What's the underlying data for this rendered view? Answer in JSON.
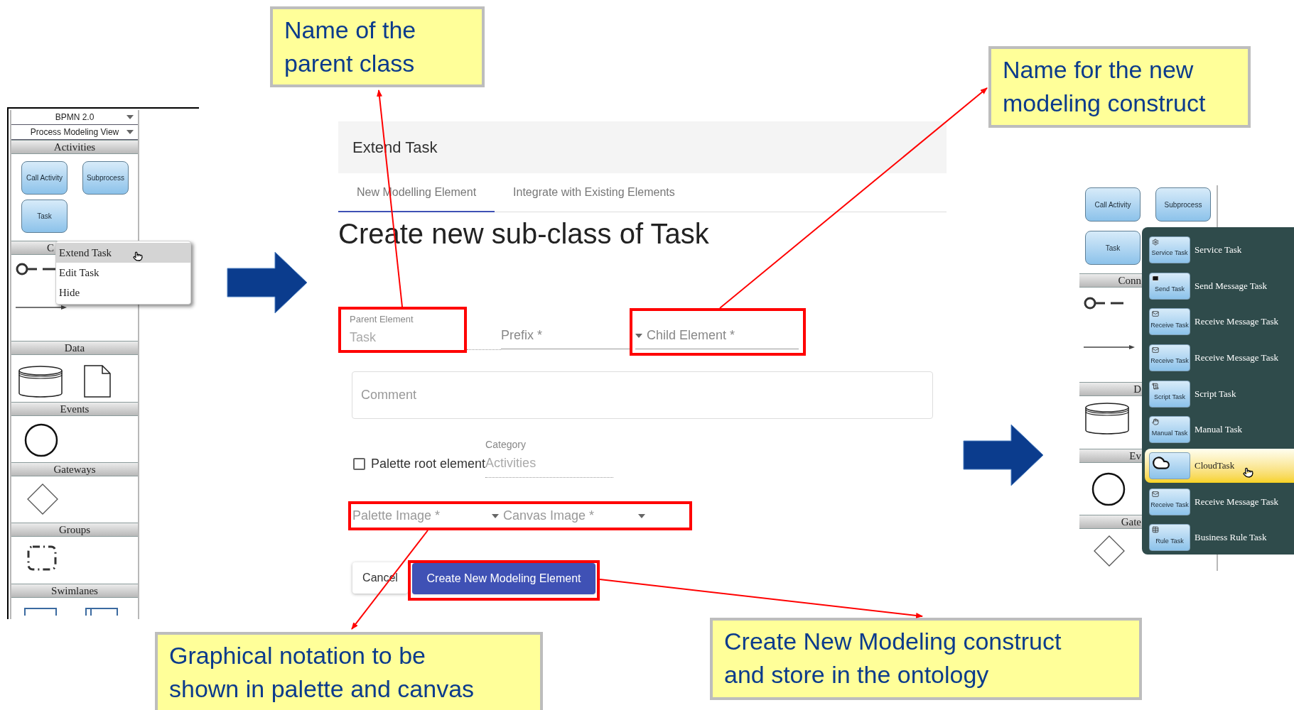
{
  "callouts": [
    {
      "text": "Name of the parent class"
    },
    {
      "text": "Name for the new modeling construct"
    },
    {
      "text": "Graphical notation to be shown in palette and canvas"
    },
    {
      "text": "Create New Modeling construct and store in the ontology"
    }
  ],
  "left_palette": {
    "selectors": [
      "BPMN 2.0",
      "Process Modeling View"
    ],
    "sections": [
      {
        "kind": "activities",
        "title": "Activities",
        "items": [
          {
            "label": "Call Activity"
          },
          {
            "label": "Subprocess"
          },
          {
            "label": "Task"
          }
        ]
      },
      {
        "kind": "connectors",
        "title": "C"
      },
      {
        "kind": "data",
        "title": "Data"
      },
      {
        "kind": "events",
        "title": "Events"
      },
      {
        "kind": "gateways",
        "title": "Gateways"
      },
      {
        "kind": "groups",
        "title": "Groups"
      },
      {
        "kind": "swimlanes",
        "title": "Swimlanes"
      }
    ]
  },
  "context_menu": {
    "items": [
      {
        "label": "Extend Task",
        "selected": true
      },
      {
        "label": "Edit Task",
        "selected": false
      },
      {
        "label": "Hide",
        "selected": false
      }
    ]
  },
  "dialog": {
    "title": "Extend Task",
    "tabs": [
      {
        "label": "New Modelling Element",
        "selected": true
      },
      {
        "label": "Integrate with Existing Elements",
        "selected": false
      }
    ],
    "heading": "Create new sub-class of Task",
    "parent": {
      "label": "Parent Element",
      "value": "Task"
    },
    "prefix": {
      "placeholder": "Prefix *"
    },
    "child": {
      "placeholder": "Child Element *"
    },
    "comment": {
      "placeholder": "Comment"
    },
    "checkbox": {
      "label": "Palette root element",
      "checked": false
    },
    "category": {
      "label": "Category",
      "value": "Activities"
    },
    "palette_image": {
      "placeholder": "Palette Image *"
    },
    "canvas_image": {
      "placeholder": "Canvas Image *"
    },
    "buttons": {
      "cancel": "Cancel",
      "create": "Create New Modeling Element"
    }
  },
  "right_palette": {
    "sections": [
      {
        "kind": "activities",
        "items": [
          {
            "label": "Call Activity"
          },
          {
            "label": "Subprocess"
          },
          {
            "label": "Task"
          }
        ]
      },
      {
        "kind": "connectors",
        "title": "Conn"
      },
      {
        "kind": "data",
        "title": "D"
      },
      {
        "kind": "events",
        "title": "Ev"
      },
      {
        "kind": "gateways",
        "title": "Gate"
      }
    ]
  },
  "task_menu": {
    "items": [
      {
        "kind": "service",
        "badge": "Service Task",
        "label": "Service Task",
        "selected": false
      },
      {
        "kind": "send",
        "badge": "Send Task",
        "label": "Send Message Task",
        "selected": false
      },
      {
        "kind": "receive",
        "badge": "Receive Task",
        "label": "Receive Message Task",
        "selected": false
      },
      {
        "kind": "receive",
        "badge": "Receive Task",
        "label": "Receive Message Task",
        "selected": false
      },
      {
        "kind": "script",
        "badge": "Script Task",
        "label": "Script Task",
        "selected": false
      },
      {
        "kind": "manual",
        "badge": "Manual Task",
        "label": "Manual Task",
        "selected": false
      },
      {
        "kind": "cloud",
        "label": "CloudTask",
        "selected": true
      },
      {
        "kind": "receive",
        "badge": "Receive Task",
        "label": "Receive Message Task",
        "selected": false
      },
      {
        "kind": "rule",
        "badge": "Rule Task",
        "label": "Business Rule Task",
        "selected": false
      }
    ]
  }
}
